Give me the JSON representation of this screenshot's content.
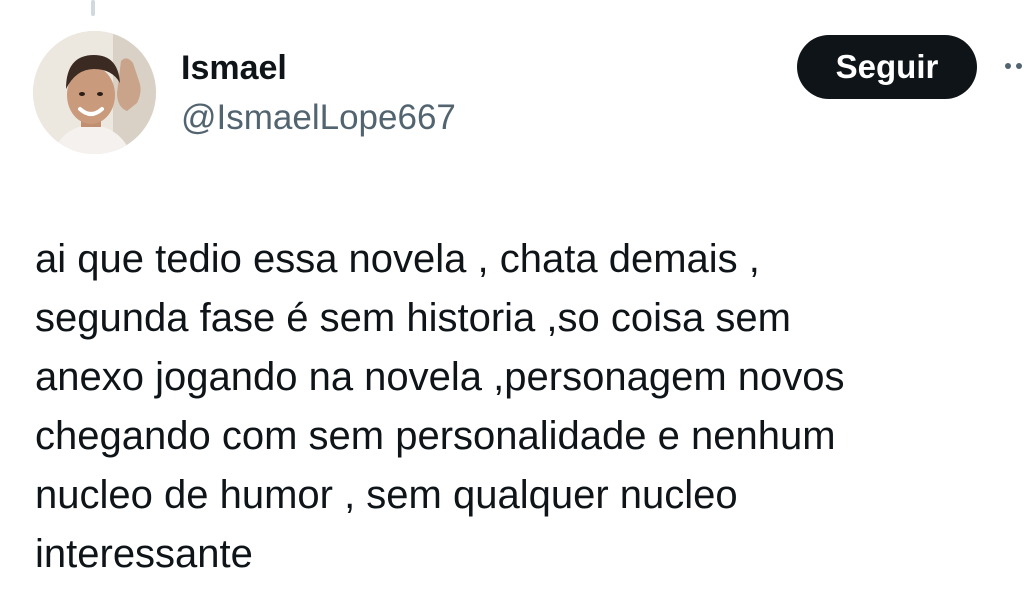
{
  "user": {
    "display_name": "Ismael",
    "handle": "@IsmaelLope667",
    "avatar_icon": "user-photo-avatar"
  },
  "actions": {
    "follow_label": "Seguir",
    "more_icon": "more-options-icon"
  },
  "tweet": {
    "text": "ai que tedio essa novela , chata demais ,\nsegunda fase é sem historia ,so coisa sem\nanexo jogando na novela ,personagem novos\nchegando com sem personalidade e nenhum\nnucleo de humor , sem qualquer nucleo\ninteressante"
  },
  "colors": {
    "text_primary": "#0f1419",
    "text_secondary": "#536471",
    "button_bg": "#0f1419",
    "button_text": "#ffffff"
  }
}
